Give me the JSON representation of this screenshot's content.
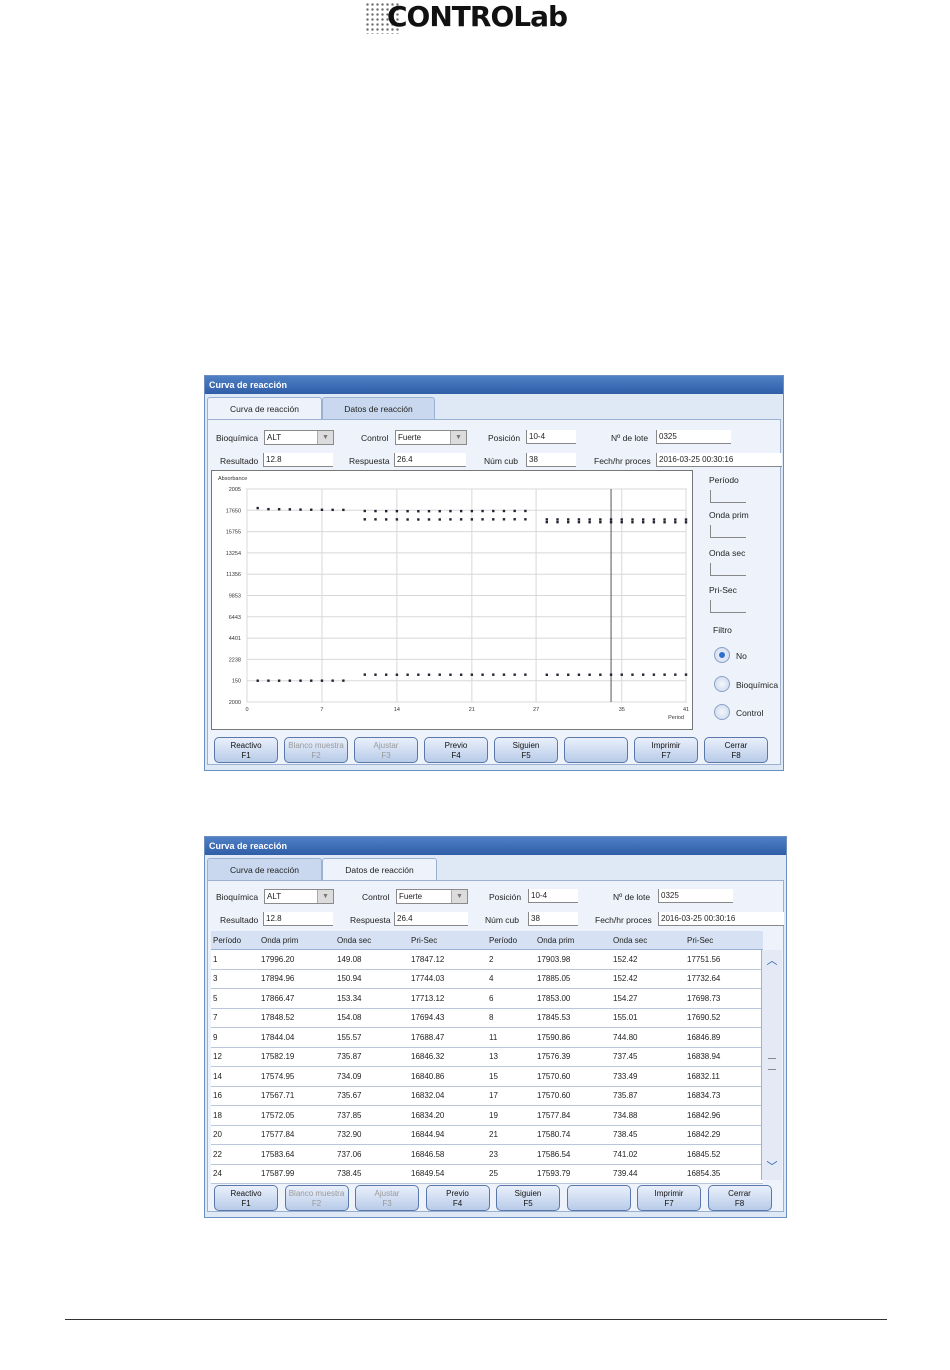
{
  "brand": {
    "logo_text": "CONTROLab"
  },
  "windows": [
    {
      "title": "Curva de reacción",
      "tabs": [
        "Curva de reacción",
        "Datos de reacción"
      ],
      "active_tab": 0,
      "fields": {
        "bioquimica_label": "Bioquímica",
        "bioquimica_value": "ALT",
        "control_label": "Control",
        "control_value": "Fuerte",
        "posicion_label": "Posición",
        "posicion_value": "10-4",
        "lote_label": "Nº de lote",
        "lote_value": "0325",
        "resultado_label": "Resultado",
        "resultado_value": "12.8",
        "respuesta_label": "Respuesta",
        "respuesta_value": "26.4",
        "numcub_label": "Núm cub",
        "numcub_value": "38",
        "fecha_label": "Fech/hr proces",
        "fecha_value": "2016-03-25 00:30:16"
      },
      "side": {
        "periodo_label": "Período",
        "onda_prim_label": "Onda prim",
        "onda_sec_label": "Onda sec",
        "pri_sec_label": "Pri-Sec",
        "filtro_label": "Filtro",
        "radios": [
          {
            "label": "No",
            "checked": true
          },
          {
            "label": "Bioquímica",
            "checked": false
          },
          {
            "label": "Control",
            "checked": false
          }
        ]
      },
      "buttons": [
        {
          "label": "Reactivo",
          "key": "F1",
          "enabled": true
        },
        {
          "label": "Blanco muestra",
          "key": "F2",
          "enabled": false
        },
        {
          "label": "Ajustar",
          "key": "F3",
          "enabled": false
        },
        {
          "label": "Previo",
          "key": "F4",
          "enabled": true
        },
        {
          "label": "Siguien",
          "key": "F5",
          "enabled": true
        },
        {
          "label": "",
          "key": "",
          "enabled": true
        },
        {
          "label": "Imprimir",
          "key": "F7",
          "enabled": true
        },
        {
          "label": "Cerrar",
          "key": "F8",
          "enabled": true
        }
      ]
    },
    {
      "title": "Curva de reacción",
      "tabs": [
        "Curva de reacción",
        "Datos de reacción"
      ],
      "active_tab": 1,
      "fields": {
        "bioquimica_label": "Bioquímica",
        "bioquimica_value": "ALT",
        "control_label": "Control",
        "control_value": "Fuerte",
        "posicion_label": "Posición",
        "posicion_value": "10-4",
        "lote_label": "Nº de lote",
        "lote_value": "0325",
        "resultado_label": "Resultado",
        "resultado_value": "12.8",
        "respuesta_label": "Respuesta",
        "respuesta_value": "26.4",
        "numcub_label": "Núm cub",
        "numcub_value": "38",
        "fecha_label": "Fech/hr proces",
        "fecha_value": "2016-03-25 00:30:16"
      },
      "table": {
        "headers": [
          "Período",
          "Onda prim",
          "Onda sec",
          "Pri-Sec",
          "Período",
          "Onda prim",
          "Onda sec",
          "Pri-Sec"
        ],
        "rows": [
          [
            "1",
            "17996.20",
            "149.08",
            "17847.12",
            "2",
            "17903.98",
            "152.42",
            "17751.56"
          ],
          [
            "3",
            "17894.96",
            "150.94",
            "17744.03",
            "4",
            "17885.05",
            "152.42",
            "17732.64"
          ],
          [
            "5",
            "17866.47",
            "153.34",
            "17713.12",
            "6",
            "17853.00",
            "154.27",
            "17698.73"
          ],
          [
            "7",
            "17848.52",
            "154.08",
            "17694.43",
            "8",
            "17845.53",
            "155.01",
            "17690.52"
          ],
          [
            "9",
            "17844.04",
            "155.57",
            "17688.47",
            "11",
            "17590.86",
            "744.80",
            "16846.89"
          ],
          [
            "12",
            "17582.19",
            "735.87",
            "16846.32",
            "13",
            "17576.39",
            "737.45",
            "16838.94"
          ],
          [
            "14",
            "17574.95",
            "734.09",
            "16840.86",
            "15",
            "17570.60",
            "733.49",
            "16832.11"
          ],
          [
            "16",
            "17567.71",
            "735.67",
            "16832.04",
            "17",
            "17570.60",
            "735.87",
            "16834.73"
          ],
          [
            "18",
            "17572.05",
            "737.85",
            "16834.20",
            "19",
            "17577.84",
            "734.88",
            "16842.96"
          ],
          [
            "20",
            "17577.84",
            "732.90",
            "16844.94",
            "21",
            "17580.74",
            "738.45",
            "16842.29"
          ],
          [
            "22",
            "17583.64",
            "737.06",
            "16846.58",
            "23",
            "17586.54",
            "741.02",
            "16845.52"
          ],
          [
            "24",
            "17587.99",
            "738.45",
            "16849.54",
            "25",
            "17593.79",
            "739.44",
            "16854.35"
          ]
        ]
      },
      "buttons": [
        {
          "label": "Reactivo",
          "key": "F1",
          "enabled": true
        },
        {
          "label": "Blanco muestra",
          "key": "F2",
          "enabled": false
        },
        {
          "label": "Ajustar",
          "key": "F3",
          "enabled": false
        },
        {
          "label": "Previo",
          "key": "F4",
          "enabled": true
        },
        {
          "label": "Siguien",
          "key": "F5",
          "enabled": true
        },
        {
          "label": "",
          "key": "",
          "enabled": true
        },
        {
          "label": "Imprimir",
          "key": "F7",
          "enabled": true
        },
        {
          "label": "Cerrar",
          "key": "F8",
          "enabled": true
        }
      ]
    }
  ],
  "chart_data": {
    "type": "scatter",
    "ylabel": "Absorbance",
    "xlabel": "Period",
    "x_ticks": [
      "0",
      "7",
      "14",
      "21",
      "27",
      "35",
      "41"
    ],
    "y_ticks": [
      "2005",
      "17650",
      "15755",
      "13254",
      "11356",
      "9853",
      "6443",
      "4401",
      "2238",
      "150",
      "2000"
    ],
    "xlim": [
      0,
      41
    ],
    "series": [
      {
        "x": [
          1,
          2,
          3,
          4,
          5,
          6,
          7,
          8,
          9
        ],
        "values": [
          17847,
          17752,
          17744,
          17733,
          17713,
          17699,
          17694,
          17691,
          17688
        ]
      },
      {
        "x": [
          11,
          12,
          13,
          14,
          15,
          16,
          17,
          18,
          19,
          20,
          21,
          22,
          23,
          24,
          25,
          26
        ],
        "values": [
          16847,
          16846,
          16839,
          16841,
          16832,
          16832,
          16835,
          16834,
          16843,
          16845,
          16842,
          16847,
          16846,
          16850,
          16854,
          16850
        ]
      },
      {
        "x": [
          11,
          12,
          13,
          14,
          15,
          16,
          17,
          18,
          19,
          20,
          21,
          22,
          23,
          24,
          25,
          26
        ],
        "values": [
          17591,
          17582,
          17576,
          17575,
          17571,
          17568,
          17571,
          17572,
          17578,
          17578,
          17581,
          17584,
          17587,
          17588,
          17594,
          17590
        ]
      },
      {
        "x": [
          28,
          29,
          30,
          31,
          32,
          33,
          34,
          35,
          36,
          37,
          38,
          39,
          40,
          41
        ],
        "values": [
          16600,
          16598,
          16596,
          16595,
          16593,
          16592,
          16591,
          16590,
          16589,
          16588,
          16587,
          16586,
          16585,
          16584
        ]
      },
      {
        "x": [
          28,
          29,
          30,
          31,
          32,
          33,
          34,
          35,
          36,
          37,
          38,
          39,
          40,
          41
        ],
        "values": [
          16840,
          16838,
          16836,
          16835,
          16834,
          16833,
          16832,
          16831,
          16830,
          16829,
          16828,
          16827,
          16826,
          16825
        ]
      },
      {
        "x": [
          1,
          2,
          3,
          4,
          5,
          6,
          7,
          8,
          9
        ],
        "values": [
          149,
          152,
          151,
          152,
          153,
          154,
          154,
          155,
          156
        ]
      },
      {
        "x": [
          11,
          12,
          13,
          14,
          15,
          16,
          17,
          18,
          19,
          20,
          21,
          22,
          23,
          24,
          25,
          26
        ],
        "values": [
          745,
          736,
          737,
          734,
          733,
          736,
          736,
          738,
          735,
          733,
          738,
          737,
          741,
          738,
          739,
          740
        ]
      },
      {
        "x": [
          28,
          29,
          30,
          31,
          32,
          33,
          34,
          35,
          36,
          37,
          38,
          39,
          40,
          41
        ],
        "values": [
          730,
          731,
          732,
          733,
          734,
          735,
          736,
          737,
          738,
          739,
          740,
          741,
          742,
          743
        ]
      }
    ],
    "vlines": [
      34
    ],
    "grid": true
  }
}
